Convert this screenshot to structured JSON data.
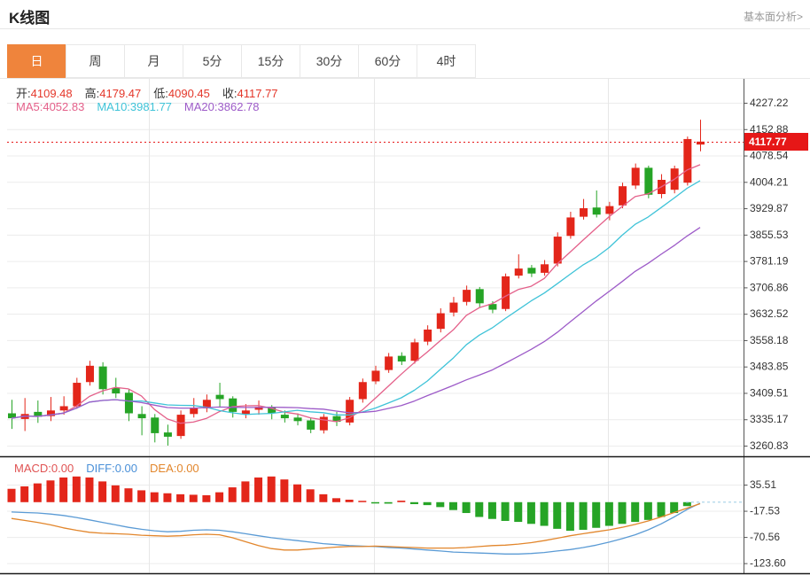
{
  "header": {
    "title": "K线图",
    "link": "基本面分析>"
  },
  "tabs": {
    "items": [
      "日",
      "周",
      "月",
      "5分",
      "15分",
      "30分",
      "60分",
      "4时"
    ],
    "selected_index": 0
  },
  "ohlc_legend": [
    {
      "label": "开:",
      "value": "4109.48"
    },
    {
      "label": "高:",
      "value": "4179.47"
    },
    {
      "label": "低:",
      "value": "4090.45"
    },
    {
      "label": "收:",
      "value": "4117.77"
    }
  ],
  "ma_legend": [
    {
      "label": "MA5:",
      "value": "4052.83",
      "color": "#e4608a"
    },
    {
      "label": "MA10:",
      "value": "3981.77",
      "color": "#3fc3d8"
    },
    {
      "label": "MA20:",
      "value": "3862.78",
      "color": "#9d5bc8"
    }
  ],
  "macd_legend": [
    {
      "label": "MACD:",
      "value": "0.00",
      "color": "#e05353"
    },
    {
      "label": "DIFF:",
      "value": "0.00",
      "color": "#4a90d8"
    },
    {
      "label": "DEA:",
      "value": "0.00",
      "color": "#e2862c"
    }
  ],
  "price_marker": {
    "value": "4117.77",
    "bg": "#e61717",
    "text_color": "#ffffff"
  },
  "colors": {
    "up": "#e3261a",
    "down": "#26a426",
    "ma5": "#e4608a",
    "ma10": "#3fc3d8",
    "ma20": "#9d5bc8",
    "diff": "#5b9bd5",
    "dea": "#e2862c",
    "grid": "#ececec",
    "vgrid": "#e7e7e7",
    "axis": "#555555",
    "dotted": "#e61717",
    "zero_dash": "#aed6ea",
    "separator": "#1a1a1a"
  },
  "chart_data": {
    "type": "candlestick",
    "title": "K线图",
    "main_axis_labels": [
      "4227.22",
      "4152.88",
      "4078.54",
      "4004.21",
      "3929.87",
      "3855.53",
      "3781.19",
      "3706.86",
      "3632.52",
      "3558.18",
      "3483.85",
      "3409.51",
      "3335.17",
      "3260.83"
    ],
    "macd_axis_labels": [
      "35.51",
      "-17.53",
      "-70.56",
      "-123.60"
    ],
    "current_price": 4117.77,
    "ma_periods": [
      5,
      10,
      20
    ],
    "candles": [
      [
        3352,
        3390,
        3308,
        3338
      ],
      [
        3336,
        3395,
        3302,
        3350
      ],
      [
        3356,
        3388,
        3325,
        3342
      ],
      [
        3344,
        3398,
        3330,
        3360
      ],
      [
        3360,
        3400,
        3348,
        3372
      ],
      [
        3372,
        3452,
        3365,
        3438
      ],
      [
        3440,
        3500,
        3430,
        3486
      ],
      [
        3484,
        3496,
        3405,
        3420
      ],
      [
        3424,
        3452,
        3395,
        3408
      ],
      [
        3410,
        3420,
        3330,
        3352
      ],
      [
        3350,
        3372,
        3290,
        3338
      ],
      [
        3340,
        3350,
        3270,
        3296
      ],
      [
        3298,
        3320,
        3261,
        3286
      ],
      [
        3288,
        3360,
        3280,
        3348
      ],
      [
        3350,
        3395,
        3340,
        3368
      ],
      [
        3366,
        3405,
        3355,
        3390
      ],
      [
        3404,
        3438,
        3368,
        3392
      ],
      [
        3394,
        3400,
        3340,
        3356
      ],
      [
        3350,
        3378,
        3338,
        3360
      ],
      [
        3362,
        3388,
        3348,
        3370
      ],
      [
        3368,
        3375,
        3335,
        3352
      ],
      [
        3348,
        3360,
        3326,
        3338
      ],
      [
        3340,
        3352,
        3318,
        3330
      ],
      [
        3332,
        3340,
        3296,
        3306
      ],
      [
        3304,
        3350,
        3295,
        3342
      ],
      [
        3344,
        3356,
        3316,
        3328
      ],
      [
        3326,
        3398,
        3318,
        3390
      ],
      [
        3392,
        3450,
        3382,
        3440
      ],
      [
        3442,
        3486,
        3434,
        3472
      ],
      [
        3474,
        3522,
        3466,
        3512
      ],
      [
        3514,
        3524,
        3488,
        3498
      ],
      [
        3500,
        3562,
        3492,
        3552
      ],
      [
        3554,
        3600,
        3544,
        3588
      ],
      [
        3590,
        3648,
        3580,
        3634
      ],
      [
        3636,
        3680,
        3625,
        3664
      ],
      [
        3666,
        3712,
        3656,
        3700
      ],
      [
        3702,
        3708,
        3650,
        3662
      ],
      [
        3660,
        3668,
        3634,
        3644
      ],
      [
        3646,
        3746,
        3640,
        3738
      ],
      [
        3740,
        3800,
        3732,
        3760
      ],
      [
        3762,
        3770,
        3736,
        3746
      ],
      [
        3748,
        3784,
        3740,
        3772
      ],
      [
        3774,
        3862,
        3766,
        3850
      ],
      [
        3852,
        3920,
        3844,
        3904
      ],
      [
        3906,
        3956,
        3898,
        3930
      ],
      [
        3932,
        3980,
        3904,
        3912
      ],
      [
        3914,
        3948,
        3896,
        3936
      ],
      [
        3938,
        4002,
        3930,
        3992
      ],
      [
        3994,
        4056,
        3984,
        4044
      ],
      [
        4044,
        4050,
        3958,
        3968
      ],
      [
        3970,
        4026,
        3958,
        4010
      ],
      [
        3982,
        4050,
        3972,
        4042
      ],
      [
        4002,
        4132,
        3994,
        4125
      ],
      [
        4109.48,
        4179.47,
        4090.45,
        4117.77
      ]
    ],
    "macd_hist": [
      27,
      32,
      38,
      44,
      50,
      52,
      50,
      42,
      34,
      28,
      24,
      20,
      18,
      16,
      15,
      14,
      20,
      30,
      42,
      50,
      52,
      46,
      36,
      26,
      16,
      8,
      5,
      2,
      -2,
      -3,
      3,
      -4,
      -6,
      -10,
      -16,
      -22,
      -30,
      -34,
      -38,
      -40,
      -44,
      -48,
      -54,
      -58,
      -56,
      -52,
      -48,
      -44,
      -40,
      -36,
      -30,
      -22,
      -8,
      0
    ],
    "macd_diff": [
      -20,
      -21,
      -22,
      -24,
      -27,
      -31,
      -36,
      -41,
      -46,
      -51,
      -55,
      -58,
      -60,
      -59,
      -57,
      -56,
      -57,
      -60,
      -64,
      -68,
      -72,
      -75,
      -78,
      -81,
      -84,
      -86,
      -88,
      -89,
      -90,
      -92,
      -93,
      -95,
      -97,
      -99,
      -101,
      -102,
      -103,
      -104,
      -105,
      -105,
      -104,
      -102,
      -99,
      -96,
      -92,
      -87,
      -81,
      -74,
      -66,
      -56,
      -44,
      -30,
      -15,
      -2
    ],
    "macd_dea": [
      -33,
      -37,
      -41,
      -46,
      -52,
      -57,
      -61,
      -63,
      -64,
      -65,
      -67,
      -68,
      -69,
      -68,
      -66,
      -65,
      -66,
      -72,
      -80,
      -88,
      -94,
      -97,
      -97,
      -95,
      -93,
      -91,
      -90,
      -90,
      -89,
      -90,
      -91,
      -92,
      -93,
      -93,
      -93,
      -92,
      -90,
      -88,
      -87,
      -85,
      -82,
      -78,
      -73,
      -68,
      -64,
      -60,
      -56,
      -51,
      -45,
      -38,
      -30,
      -21,
      -12,
      -3
    ]
  }
}
